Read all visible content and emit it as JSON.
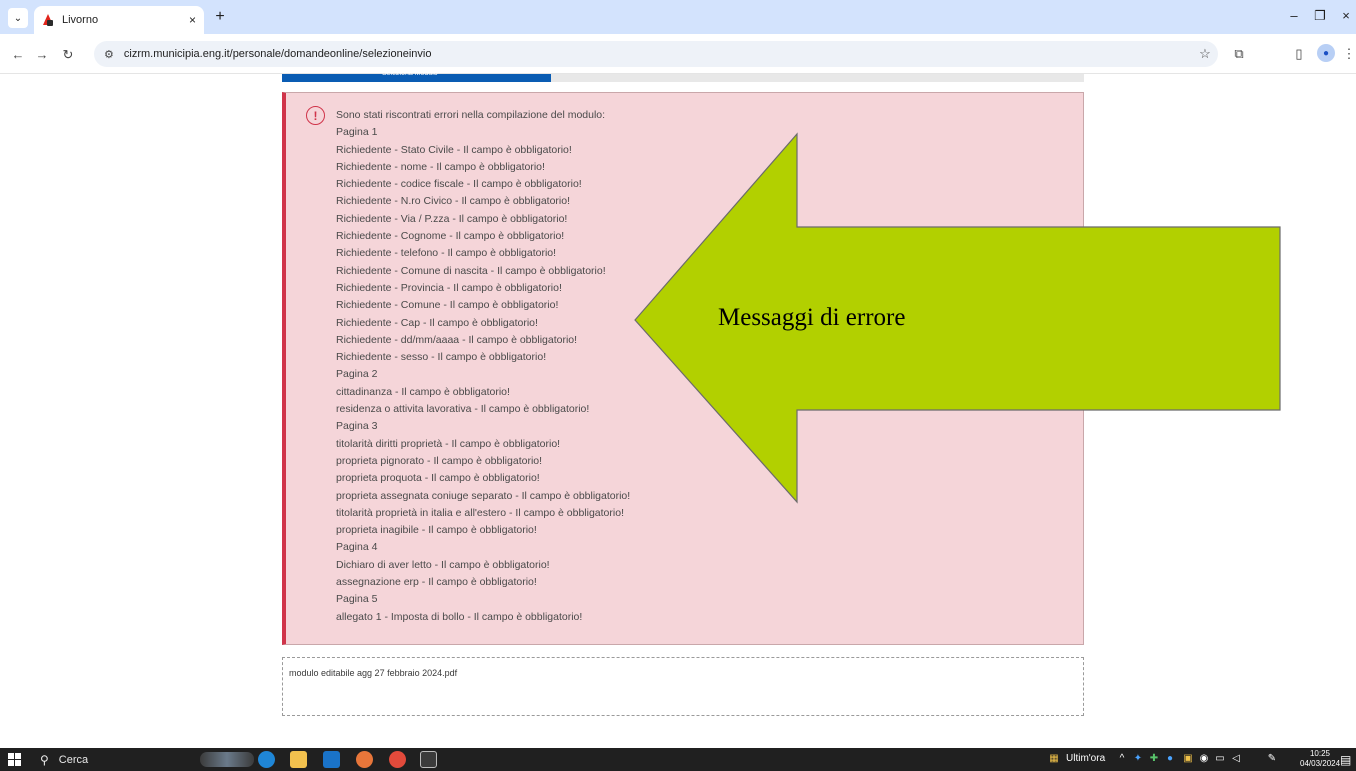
{
  "browser": {
    "tab_title": "Livorno",
    "tab_close": "×",
    "new_tab": "+",
    "url": "cizrm.municipia.eng.it/personale/domandeonline/selezioneinvio",
    "window_controls": {
      "minimize": "–",
      "restore": "❐",
      "close": "×"
    },
    "icons": [
      "chevron-down-icon",
      "back-icon",
      "forward-icon",
      "reload-icon",
      "site-info-icon",
      "star-icon",
      "extensions-icon",
      "sidebar-icon",
      "profile-icon",
      "more-icon"
    ]
  },
  "page": {
    "progress": {
      "label": "Seleziona Modulo",
      "fraction": 0.335
    },
    "error_messages": [
      "Sono stati riscontrati errori nella compilazione del modulo:",
      "Pagina 1",
      "Richiedente - Stato Civile - Il campo è obbligatorio!",
      "Richiedente - nome - Il campo è obbligatorio!",
      "Richiedente - codice fiscale - Il campo è obbligatorio!",
      "Richiedente - N.ro Civico - Il campo è obbligatorio!",
      "Richiedente - Via / P.zza - Il campo è obbligatorio!",
      "Richiedente - Cognome - Il campo è obbligatorio!",
      "Richiedente - telefono - Il campo è obbligatorio!",
      "Richiedente - Comune di nascita - Il campo è obbligatorio!",
      "Richiedente - Provincia - Il campo è obbligatorio!",
      "Richiedente - Comune - Il campo è obbligatorio!",
      "Richiedente - Cap - Il campo è obbligatorio!",
      "Richiedente - dd/mm/aaaa - Il campo è obbligatorio!",
      "Richiedente - sesso - Il campo è obbligatorio!",
      "Pagina 2",
      "cittadinanza - Il campo è obbligatorio!",
      "residenza o attivita lavorativa - Il campo è obbligatorio!",
      "Pagina 3",
      "titolarità diritti proprietà - Il campo è obbligatorio!",
      "proprieta pignorato - Il campo è obbligatorio!",
      "proprieta proquota - Il campo è obbligatorio!",
      "proprieta assegnata coniuge separato - Il campo è obbligatorio!",
      "titolarità proprietà in italia e all'estero - Il campo è obbligatorio!",
      "proprieta inagibile - Il campo è obbligatorio!",
      "Pagina 4",
      "Dichiaro di aver letto - Il campo è obbligatorio!",
      "assegnazione erp - Il campo è obbligatorio!",
      "Pagina 5",
      "allegato 1 - Imposta di bollo - Il campo è obbligatorio!"
    ],
    "file_name": "modulo editabile agg 27 febbraio 2024.pdf"
  },
  "annotation": {
    "text": "Messaggi di errore",
    "arrow_color": "#b2d000"
  },
  "taskbar": {
    "search_label": "Cerca",
    "news_label": "Ultim'ora",
    "time": "10:25",
    "date": "04/03/2024"
  },
  "colors": {
    "error_bg": "#f5d5d9",
    "error_accent": "#d0344a",
    "progress_blue": "#0a5cb3",
    "tab_bar": "#d3e3fd"
  }
}
